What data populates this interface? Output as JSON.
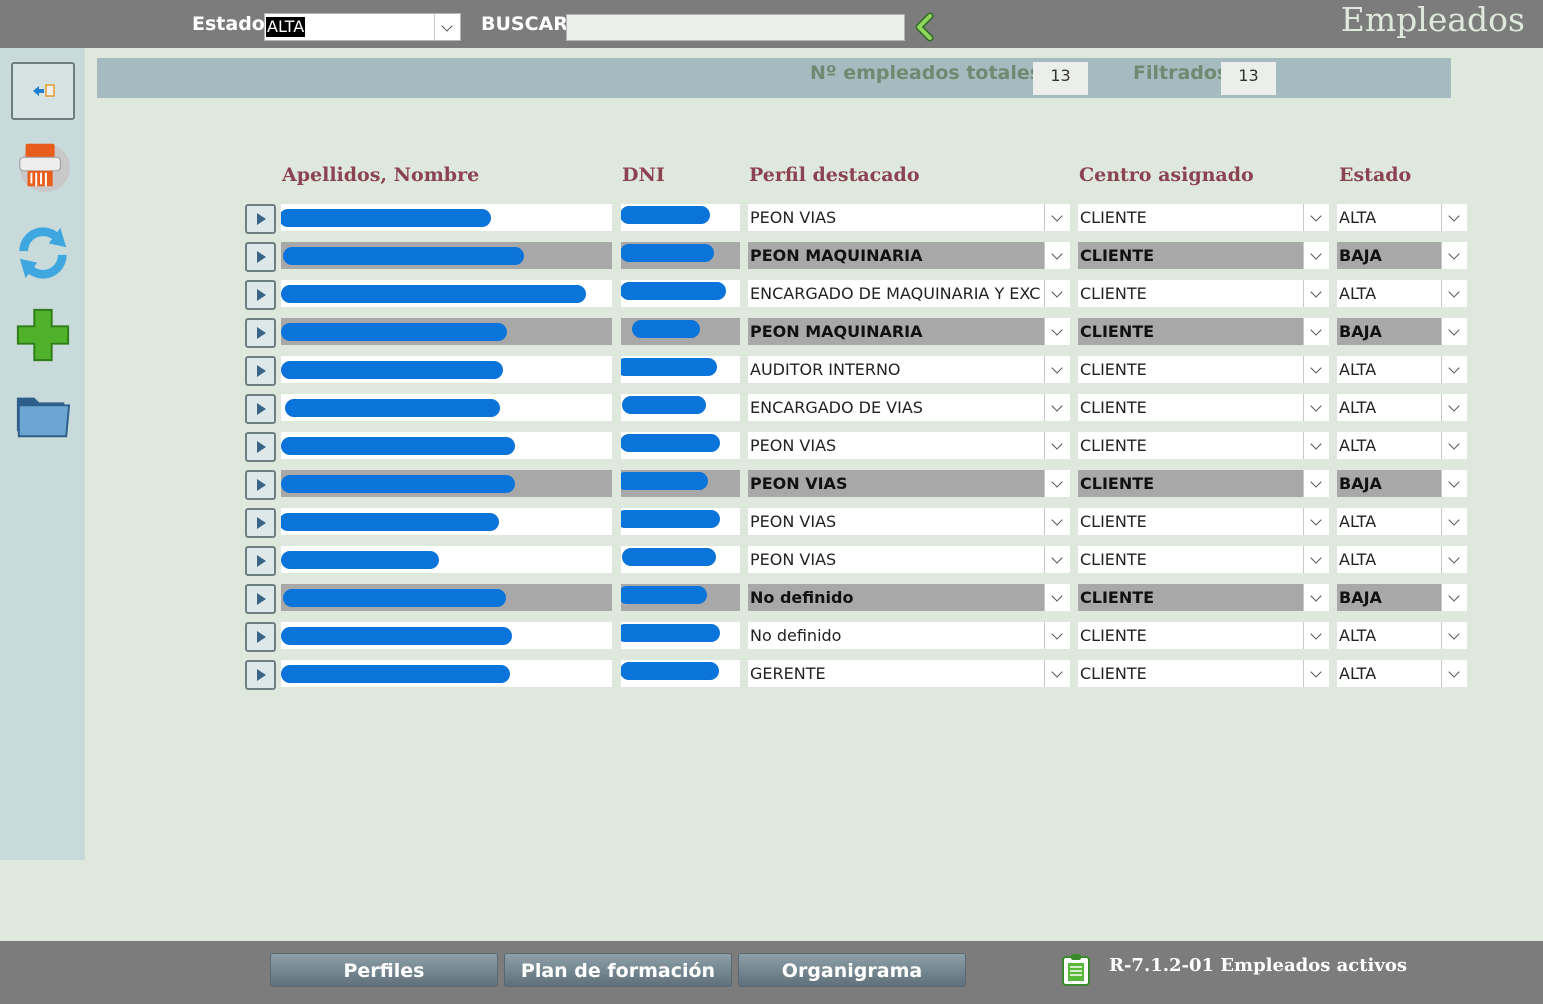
{
  "window": {
    "title": "Empleados"
  },
  "filters": {
    "estado_label": "Estado",
    "estado_value": "ALTA",
    "buscar_label": "BUSCAR",
    "buscar_value": ""
  },
  "counts": {
    "total_label": "Nº empleados totales:",
    "total_value": "13",
    "filtrados_label": "Filtrados",
    "filtrados_value": "13"
  },
  "sidebar": {
    "icons": [
      "exit-icon",
      "pdf-report-icon",
      "refresh-icon",
      "add-icon",
      "folder-icon"
    ]
  },
  "table": {
    "headers": {
      "nombre": "Apellidos, Nombre",
      "dni": "DNI",
      "perfil": "Perfil destacado",
      "centro": "Centro asignado",
      "estado": "Estado"
    },
    "rows": [
      {
        "perfil": "PEON VIAS",
        "centro": "CLIENTE",
        "estado": "ALTA"
      },
      {
        "perfil": "PEON MAQUINARIA",
        "centro": "CLIENTE",
        "estado": "BAJA"
      },
      {
        "perfil": "ENCARGADO DE MAQUINARIA Y EXC",
        "centro": "CLIENTE",
        "estado": "ALTA"
      },
      {
        "perfil": "PEON MAQUINARIA",
        "centro": "CLIENTE",
        "estado": "BAJA"
      },
      {
        "perfil": "AUDITOR INTERNO",
        "centro": "CLIENTE",
        "estado": "ALTA"
      },
      {
        "perfil": "ENCARGADO DE VIAS",
        "centro": "CLIENTE",
        "estado": "ALTA"
      },
      {
        "perfil": "PEON VIAS",
        "centro": "CLIENTE",
        "estado": "ALTA"
      },
      {
        "perfil": "PEON VIAS",
        "centro": "CLIENTE",
        "estado": "BAJA"
      },
      {
        "perfil": "PEON VIAS",
        "centro": "CLIENTE",
        "estado": "ALTA"
      },
      {
        "perfil": "PEON VIAS",
        "centro": "CLIENTE",
        "estado": "ALTA"
      },
      {
        "perfil": "No definido",
        "centro": "CLIENTE",
        "estado": "BAJA"
      },
      {
        "perfil": "No definido",
        "centro": "CLIENTE",
        "estado": "ALTA"
      },
      {
        "perfil": "GERENTE",
        "centro": "CLIENTE",
        "estado": "ALTA"
      }
    ]
  },
  "footer": {
    "perfiles": "Perfiles",
    "plan": "Plan de formación",
    "organigrama": "Organigrama",
    "report": "R-7.1.2-01 Empleados activos"
  },
  "colors": {
    "bar": "#7c7c7c",
    "background": "#dfe8dc",
    "header_text": "#8b4253",
    "redaction": "#0a74da",
    "baja_row": "#a8a8a8"
  }
}
